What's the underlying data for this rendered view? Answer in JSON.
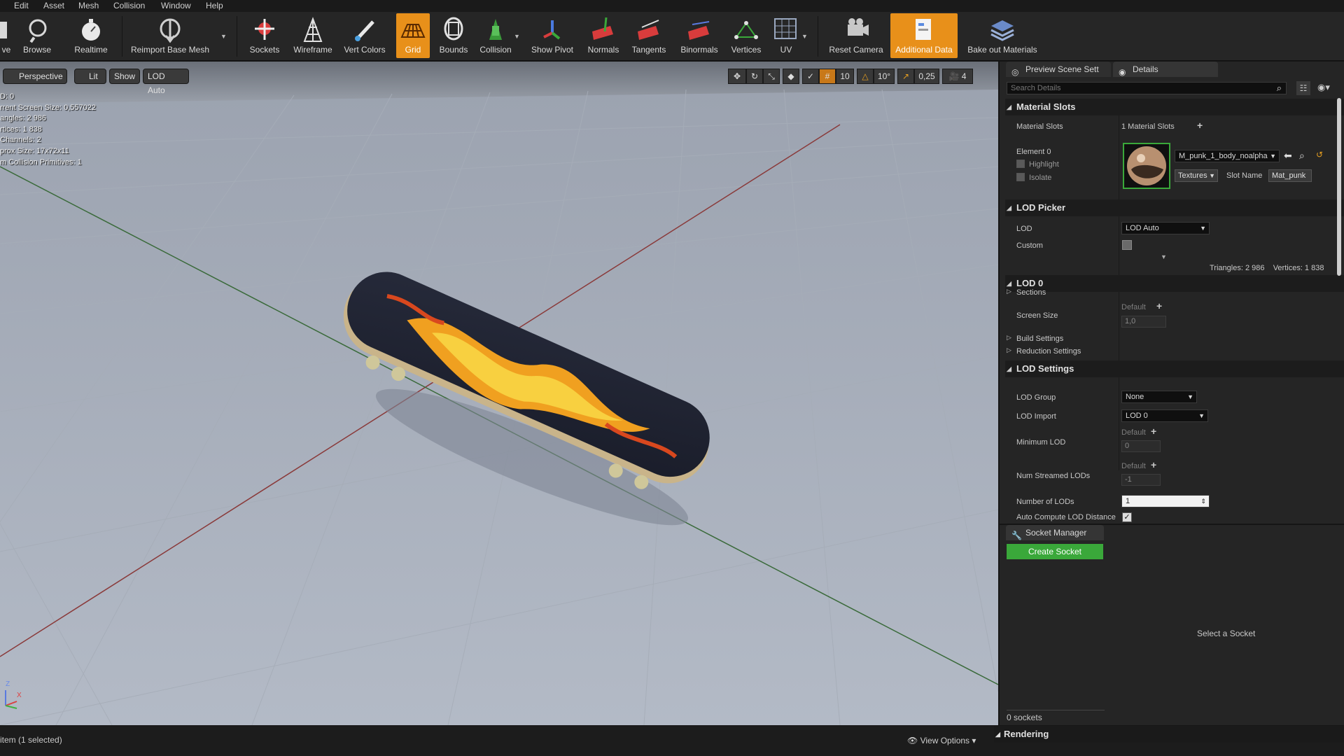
{
  "menu": [
    "Edit",
    "Asset",
    "Mesh",
    "Collision",
    "Window",
    "Help"
  ],
  "toolbar": {
    "save_partial": "ve",
    "browse": "Browse",
    "realtime": "Realtime",
    "reimport": "Reimport Base Mesh",
    "sockets": "Sockets",
    "wireframe": "Wireframe",
    "vert_colors": "Vert Colors",
    "grid": "Grid",
    "bounds": "Bounds",
    "collision": "Collision",
    "show_pivot": "Show Pivot",
    "normals": "Normals",
    "tangents": "Tangents",
    "binormals": "Binormals",
    "vertices": "Vertices",
    "uv": "UV",
    "reset_camera": "Reset Camera",
    "additional_data": "Additional Data",
    "bake_out": "Bake out Materials",
    "active_color": "#e8901a"
  },
  "viewport": {
    "perspective": "Perspective",
    "lit": "Lit",
    "show": "Show",
    "lod_auto": "LOD Auto",
    "stats": [
      "D:  0",
      "rrent Screen Size:  0,557022",
      "angles:  2 986",
      "rtices:  1 838",
      " Channels:  2",
      "prox Size:  17x72x11",
      "m Collision Primitives:  1"
    ],
    "grid_snap": "10",
    "rot_snap": "10°",
    "scale_snap": "0,25",
    "cam_speed": "4",
    "axis_x": "X",
    "axis_z": "Z"
  },
  "tabs": {
    "preview_scene": "Preview Scene Sett",
    "details": "Details"
  },
  "details": {
    "search_placeholder": "Search Details",
    "material_slots_header": "Material Slots",
    "material_slots_label": "Material Slots",
    "material_slots_value": "1 Material Slots",
    "element0": "Element 0",
    "highlight": "Highlight",
    "isolate": "Isolate",
    "material_name": "M_punk_1_body_noalpha",
    "textures": "Textures",
    "slot_name_label": "Slot Name",
    "slot_name_value": "Mat_punk",
    "lod_picker_header": "LOD Picker",
    "lod_label": "LOD",
    "lod_value": "LOD Auto",
    "custom_label": "Custom",
    "tri_vert": "Triangles: 2 986    Vertices: 1 838",
    "lod0_header": "LOD 0",
    "sections": "Sections",
    "screen_size_label": "Screen Size",
    "default": "Default",
    "screen_size_value": "1,0",
    "build_settings": "Build Settings",
    "reduction_settings": "Reduction Settings",
    "lod_settings_header": "LOD Settings",
    "lod_group_label": "LOD Group",
    "lod_group_value": "None",
    "lod_import_label": "LOD Import",
    "lod_import_value": "LOD 0",
    "min_lod_label": "Minimum LOD",
    "min_lod_value": "0",
    "num_streamed_label": "Num Streamed LODs",
    "num_streamed_value": "-1",
    "num_lods_label": "Number of LODs",
    "num_lods_value": "1",
    "auto_compute_label": "Auto Compute LOD Distance"
  },
  "socket_manager": {
    "tab": "Socket Manager",
    "create": "Create Socket",
    "select": "Select a Socket",
    "count": "0 sockets",
    "create_color": "#3aa83a"
  },
  "statusbar": {
    "selection": "item (1 selected)",
    "view_options": "View Options",
    "rendering": "Rendering"
  }
}
